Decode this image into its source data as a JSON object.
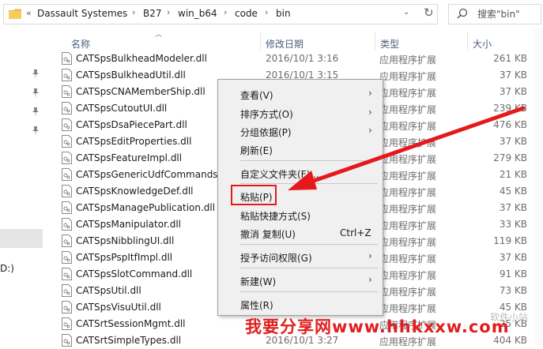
{
  "address": {
    "back_chevron": "«",
    "crumbs": [
      "Dassault Systemes",
      "B27",
      "win_b64",
      "code",
      "bin"
    ],
    "separator": "›",
    "dropdown": "⌄",
    "refresh": "↻"
  },
  "search": {
    "placeholder": "搜索\"bin\""
  },
  "nav": {
    "drive_label": "D:)"
  },
  "columns": {
    "name": "名称",
    "date": "修改日期",
    "type": "类型",
    "size": "大小"
  },
  "files": [
    {
      "name": "CATSpsBulkheadModeler.dll",
      "date": "2016/10/1 3:16",
      "type": "应用程序扩展",
      "size": "261 KB"
    },
    {
      "name": "CATSpsBulkheadUtil.dll",
      "date": "2016/10/1 3:15",
      "type": "应用程序扩展",
      "size": "37 KB"
    },
    {
      "name": "CATSpsCNAMemberShip.dll",
      "date": "",
      "type": "应用程序扩展",
      "size": "37 KB"
    },
    {
      "name": "CATSpsCutoutUI.dll",
      "date": "",
      "type": "应用程序扩展",
      "size": "239 KB"
    },
    {
      "name": "CATSpsDsaPiecePart.dll",
      "date": "",
      "type": "应用程序扩展",
      "size": "476 KB"
    },
    {
      "name": "CATSpsEditProperties.dll",
      "date": "",
      "type": "应用程序扩展",
      "size": "37 KB"
    },
    {
      "name": "CATSpsFeatureImpl.dll",
      "date": "",
      "type": "应用程序扩展",
      "size": "279 KB"
    },
    {
      "name": "CATSpsGenericUdfCommands",
      "date": "",
      "type": "应用程序扩展",
      "size": "21 KB"
    },
    {
      "name": "CATSpsKnowledgeDef.dll",
      "date": "",
      "type": "应用程序扩展",
      "size": "45 KB"
    },
    {
      "name": "CATSpsManagePublication.dll",
      "date": "",
      "type": "应用程序扩展",
      "size": "37 KB"
    },
    {
      "name": "CATSpsManipulator.dll",
      "date": "",
      "type": "应用程序扩展",
      "size": "33 KB"
    },
    {
      "name": "CATSpsNibblingUI.dll",
      "date": "",
      "type": "应用程序扩展",
      "size": "119 KB"
    },
    {
      "name": "CATSpsPspItfImpl.dll",
      "date": "",
      "type": "应用程序扩展",
      "size": "37 KB"
    },
    {
      "name": "CATSpsSlotCommand.dll",
      "date": "",
      "type": "应用程序扩展",
      "size": "91 KB"
    },
    {
      "name": "CATSpsUtil.dll",
      "date": "",
      "type": "应用程序扩展",
      "size": "73 KB"
    },
    {
      "name": "CATSpsVisuUtil.dll",
      "date": "",
      "type": "应用程序扩展",
      "size": "45 KB"
    },
    {
      "name": "CATSrtSessionMgmt.dll",
      "date": "",
      "type": "应用程序扩展",
      "size": "25 KB"
    },
    {
      "name": "CATSrtSimpleTypes.dll",
      "date": "2016/10/1 3:27",
      "type": "应用程序扩展",
      "size": "404 KB"
    }
  ],
  "context_menu": {
    "view": "查看(V)",
    "sort_by": "排序方式(O)",
    "group_by": "分组依据(P)",
    "refresh": "刷新(E)",
    "customize_folder": "自定义文件夹(F)...",
    "paste": "粘贴(P)",
    "paste_shortcut": "粘贴快捷方式(S)",
    "undo_copy": "撤消 复制(U)",
    "undo_shortcut": "Ctrl+Z",
    "grant_access": "授予访问权限(G)",
    "new": "新建(W)",
    "properties": "属性(R)",
    "submenu_arrow": "›"
  },
  "watermark": {
    "text": "我要分享网www.hhkxxw.com",
    "faint_text": "软件小站"
  },
  "colors": {
    "highlight_red": "#e5191c",
    "watermark_red": "#e01f1f",
    "header_blue": "#4c607a"
  }
}
